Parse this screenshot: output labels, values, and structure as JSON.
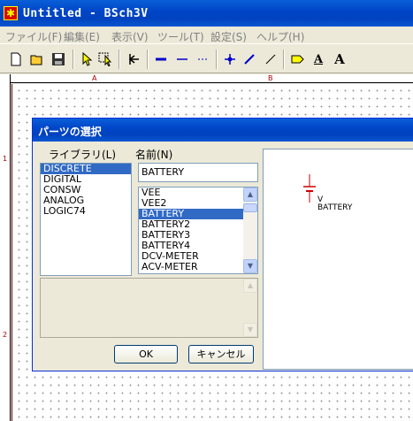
{
  "window": {
    "title": "Untitled - BSch3V",
    "icon": "bsch-app-icon"
  },
  "menu": [
    {
      "label": "ファイル(F)"
    },
    {
      "label": "編集(E)"
    },
    {
      "label": "表示(V)"
    },
    {
      "label": "ツール(T)"
    },
    {
      "label": "設定(S)"
    },
    {
      "label": "ヘルプ(H)"
    }
  ],
  "toolbar": {
    "icons": [
      "new-file-icon",
      "open-folder-icon",
      "save-icon",
      "pointer-icon",
      "select-area-icon",
      "component-icon",
      "bus-icon",
      "wire-icon",
      "dash-line-icon",
      "junction-icon",
      "entry-icon",
      "line-icon",
      "tag-icon",
      "label-icon",
      "text-icon"
    ],
    "label_a": "A",
    "text_a": "A"
  },
  "rulers": {
    "top": [
      "A",
      "B"
    ],
    "left": [
      "1",
      "2"
    ]
  },
  "dialog": {
    "title": "パーツの選択",
    "library_label": "ライブラリ(L)",
    "name_label": "名前(N)",
    "libraries": [
      {
        "name": "DISCRETE",
        "selected": true
      },
      {
        "name": "DIGITAL",
        "selected": false
      },
      {
        "name": "CONSW",
        "selected": false
      },
      {
        "name": "ANALOG",
        "selected": false
      },
      {
        "name": "LOGIC74",
        "selected": false
      }
    ],
    "name_value": "BATTERY",
    "parts": [
      {
        "name": "VEE",
        "selected": false
      },
      {
        "name": "VEE2",
        "selected": false
      },
      {
        "name": "BATTERY",
        "selected": true
      },
      {
        "name": "BATTERY2",
        "selected": false
      },
      {
        "name": "BATTERY3",
        "selected": false
      },
      {
        "name": "BATTERY4",
        "selected": false
      },
      {
        "name": "DCV-METER",
        "selected": false
      },
      {
        "name": "ACV-METER",
        "selected": false
      }
    ],
    "ok_label": "OK",
    "cancel_label": "キャンセル",
    "preview": {
      "ref": "V",
      "name": "BATTERY"
    }
  }
}
